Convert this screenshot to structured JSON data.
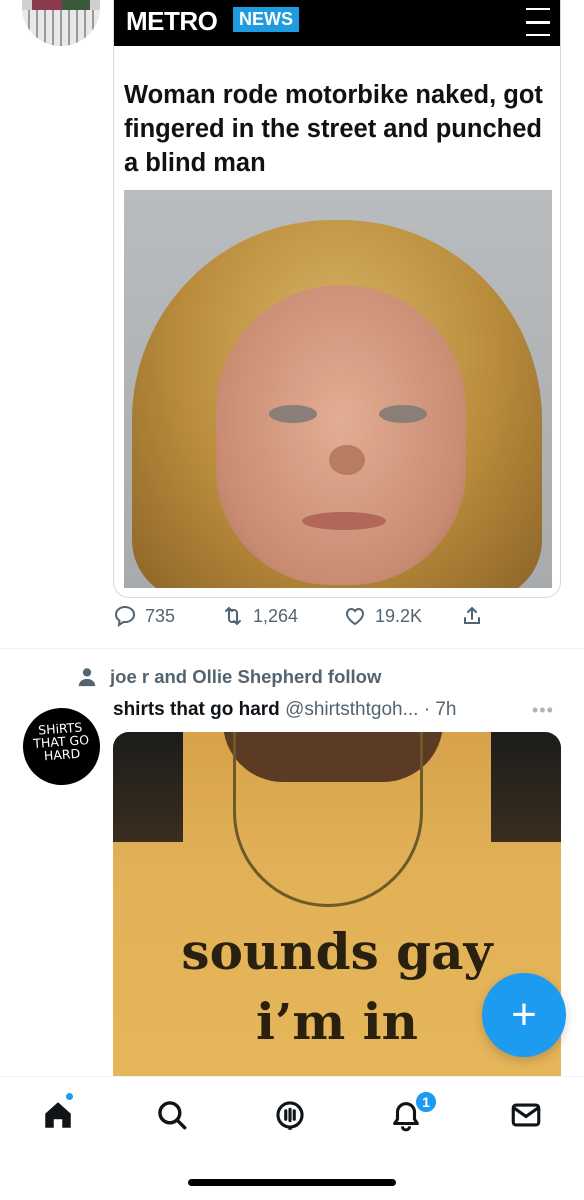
{
  "tweet1": {
    "article": {
      "logo": "METRO",
      "section": "NEWS",
      "headline": "Woman rode motorbike naked, got fingered in the street and punched a blind man"
    },
    "actions": {
      "replies": "735",
      "retweets": "1,264",
      "likes": "19.2K"
    }
  },
  "social_context": "joe r and Ollie Shepherd follow",
  "tweet2": {
    "avatar_text": "SHiRTS THAT GO HARD",
    "name": "shirts that go hard",
    "handle": "@shirtsthtgoh...",
    "separator": "·",
    "time": "7h",
    "more": "•••",
    "image_text_line1": "sounds gay",
    "image_text_line2": "i’m in"
  },
  "fab": {
    "label": "+"
  },
  "tabbar": {
    "notifications_badge": "1",
    "accent": "#1d9bf0"
  },
  "icons": [
    "reply-icon",
    "retweet-icon",
    "like-icon",
    "share-icon",
    "person-icon",
    "more-icon",
    "home-icon",
    "search-icon",
    "spaces-icon",
    "notifications-icon",
    "messages-icon",
    "menu-icon"
  ]
}
